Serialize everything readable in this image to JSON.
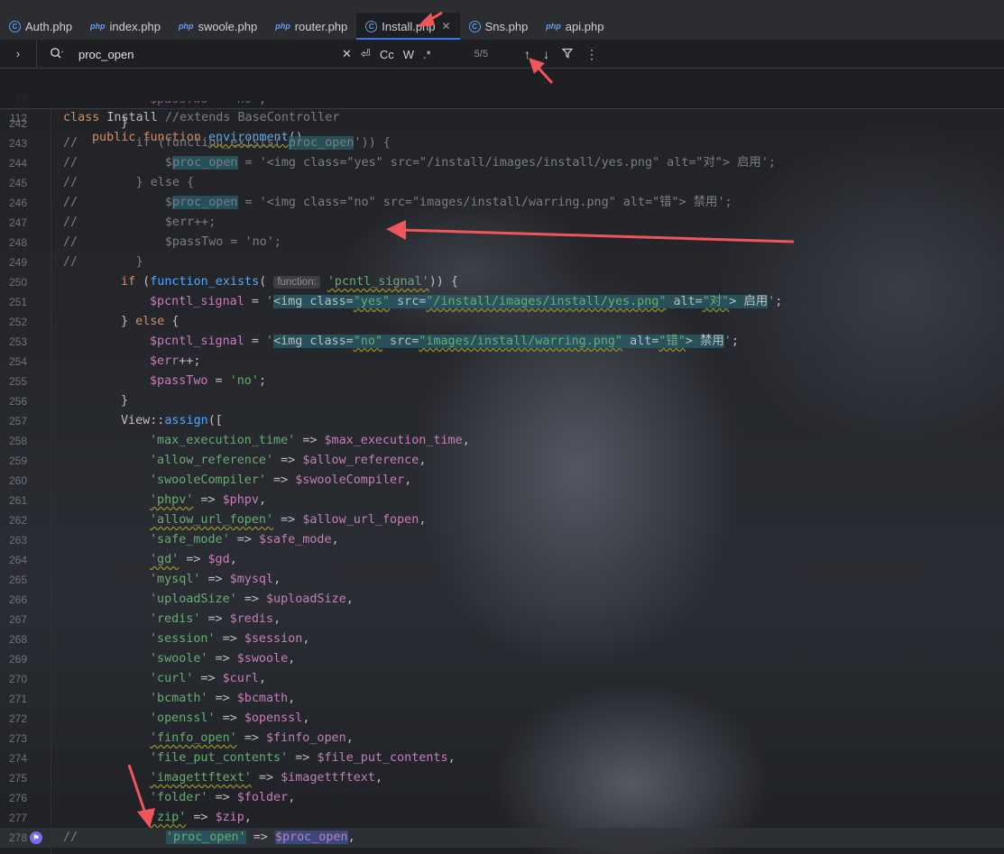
{
  "tabs": [
    {
      "label": "Auth.php",
      "icon": "class-c-icon",
      "active": false
    },
    {
      "label": "index.php",
      "icon": "php-file-icon",
      "active": false
    },
    {
      "label": "swoole.php",
      "icon": "php-file-icon",
      "active": false
    },
    {
      "label": "router.php",
      "icon": "php-file-icon",
      "active": false
    },
    {
      "label": "Install.php",
      "icon": "class-c-icon",
      "active": true
    },
    {
      "label": "Sns.php",
      "icon": "class-c-icon",
      "active": false
    },
    {
      "label": "api.php",
      "icon": "php-file-icon",
      "active": false
    }
  ],
  "find": {
    "query": "proc_open",
    "match_case_label": "Cc",
    "words_label": "W",
    "regex_label": ".*",
    "count": "5/5"
  },
  "sticky": [
    {
      "num": "29",
      "text": "class Install //extends BaseController"
    },
    {
      "num": "112",
      "text": "public function environment()"
    }
  ],
  "lines": [
    {
      "num": "242",
      "text": "}"
    },
    {
      "num": "243",
      "text": "//        if (function_exists('proc_open')) {"
    },
    {
      "num": "244",
      "text": "//            $proc_open = '<img class=\"yes\" src=\"/install/images/install/yes.png\" alt=\"对\"> 启用';"
    },
    {
      "num": "245",
      "text": "//        } else {"
    },
    {
      "num": "246",
      "text": "//            $proc_open = '<img class=\"no\" src=\"images/install/warring.png\" alt=\"错\"> 禁用';"
    },
    {
      "num": "247",
      "text": "//            $err++;"
    },
    {
      "num": "248",
      "text": "//            $passTwo = 'no';"
    },
    {
      "num": "249",
      "text": "//        }"
    },
    {
      "num": "250",
      "text": "if (function_exists("
    },
    {
      "num": "251",
      "text": "$pcntl_signal = '<img class=\"yes\" src=\"/install/images/install/yes.png\" alt=\"对\"> 启用';"
    },
    {
      "num": "252",
      "text": "} else {"
    },
    {
      "num": "253",
      "text": "$pcntl_signal = '<img class=\"no\" src=\"images/install/warring.png\" alt=\"错\"> 禁用';"
    },
    {
      "num": "254",
      "text": "$err++;"
    },
    {
      "num": "255",
      "text": "$passTwo = 'no';"
    },
    {
      "num": "256",
      "text": "}"
    },
    {
      "num": "257",
      "text": "View::assign(["
    },
    {
      "num": "258",
      "key": "'max_execution_time'",
      "val": "$max_execution_time,"
    },
    {
      "num": "259",
      "key": "'allow_reference'",
      "val": "$allow_reference,"
    },
    {
      "num": "260",
      "key": "'swooleCompiler'",
      "val": "$swooleCompiler,"
    },
    {
      "num": "261",
      "key": "'phpv'",
      "val": "$phpv,"
    },
    {
      "num": "262",
      "key": "'allow_url_fopen'",
      "val": "$allow_url_fopen,"
    },
    {
      "num": "263",
      "key": "'safe_mode'",
      "val": "$safe_mode,"
    },
    {
      "num": "264",
      "key": "'gd'",
      "val": "$gd,"
    },
    {
      "num": "265",
      "key": "'mysql'",
      "val": "$mysql,"
    },
    {
      "num": "266",
      "key": "'uploadSize'",
      "val": "$uploadSize,"
    },
    {
      "num": "267",
      "key": "'redis'",
      "val": "$redis,"
    },
    {
      "num": "268",
      "key": "'session'",
      "val": "$session,"
    },
    {
      "num": "269",
      "key": "'swoole'",
      "val": "$swoole,"
    },
    {
      "num": "270",
      "key": "'curl'",
      "val": "$curl,"
    },
    {
      "num": "271",
      "key": "'bcmath'",
      "val": "$bcmath,"
    },
    {
      "num": "272",
      "key": "'openssl'",
      "val": "$openssl,"
    },
    {
      "num": "273",
      "key": "'finfo_open'",
      "val": "$finfo_open,"
    },
    {
      "num": "274",
      "key": "'file_put_contents'",
      "val": "$file_put_contents,"
    },
    {
      "num": "275",
      "key": "'imagettftext'",
      "val": "$imagettftext,"
    },
    {
      "num": "276",
      "key": "'folder'",
      "val": "$folder,"
    },
    {
      "num": "277",
      "key": "'zip'",
      "val": "$zip,"
    },
    {
      "num": "278",
      "key": "'proc_open'",
      "val": "$proc_open,"
    }
  ],
  "inlay_hint": "function:",
  "pcntl_arg": "'pcntl_signal'",
  "colors": {
    "accent": "#3574f0",
    "annotation_arrow": "#f0555a",
    "keyword": "#cf8e6d",
    "string": "#6aab73",
    "variable": "#c77dba",
    "function": "#56a8f5",
    "comment": "#7a7e85"
  }
}
